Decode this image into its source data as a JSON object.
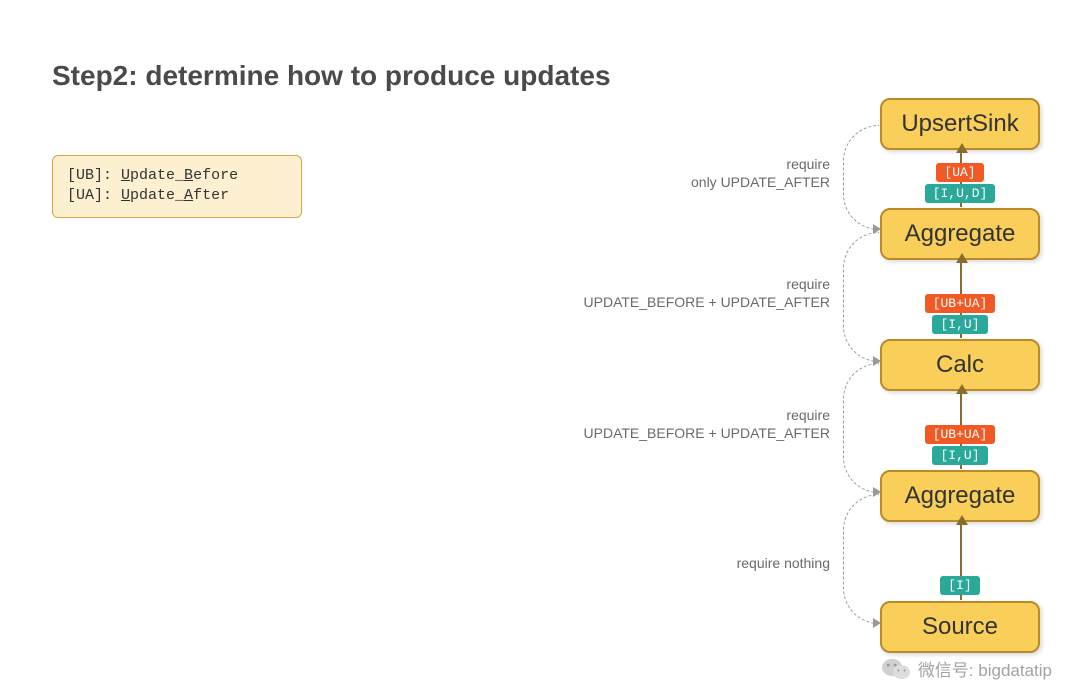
{
  "title": "Step2: determine how to produce updates",
  "legend": {
    "line1_prefix": "[UB]: ",
    "line1_u": "U",
    "line1_mid": "pdate_",
    "line1_b": "B",
    "line1_suffix": "efore",
    "line2_prefix": "[UA]: ",
    "line2_u": "U",
    "line2_mid": "pdate_",
    "line2_a": "A",
    "line2_suffix": "fter"
  },
  "nodes": {
    "sink": {
      "label": "UpsertSink"
    },
    "agg1": {
      "label": "Aggregate",
      "updates": "[UA]",
      "inputs": "[I,U,D]"
    },
    "calc": {
      "label": "Calc",
      "updates": "[UB+UA]",
      "inputs": "[I,U]"
    },
    "agg2": {
      "label": "Aggregate",
      "updates": "[UB+UA]",
      "inputs": "[I,U]"
    },
    "source": {
      "label": "Source",
      "inputs": "[I]"
    }
  },
  "req": {
    "r1a": "require",
    "r1b": "only UPDATE_AFTER",
    "r2a": "require",
    "r2b": "UPDATE_BEFORE + UPDATE_AFTER",
    "r3a": "require",
    "r3b": "UPDATE_BEFORE + UPDATE_AFTER",
    "r4": "require nothing"
  },
  "watermark": {
    "label_prefix": "微信号: ",
    "label_id": "bigdatatip"
  }
}
